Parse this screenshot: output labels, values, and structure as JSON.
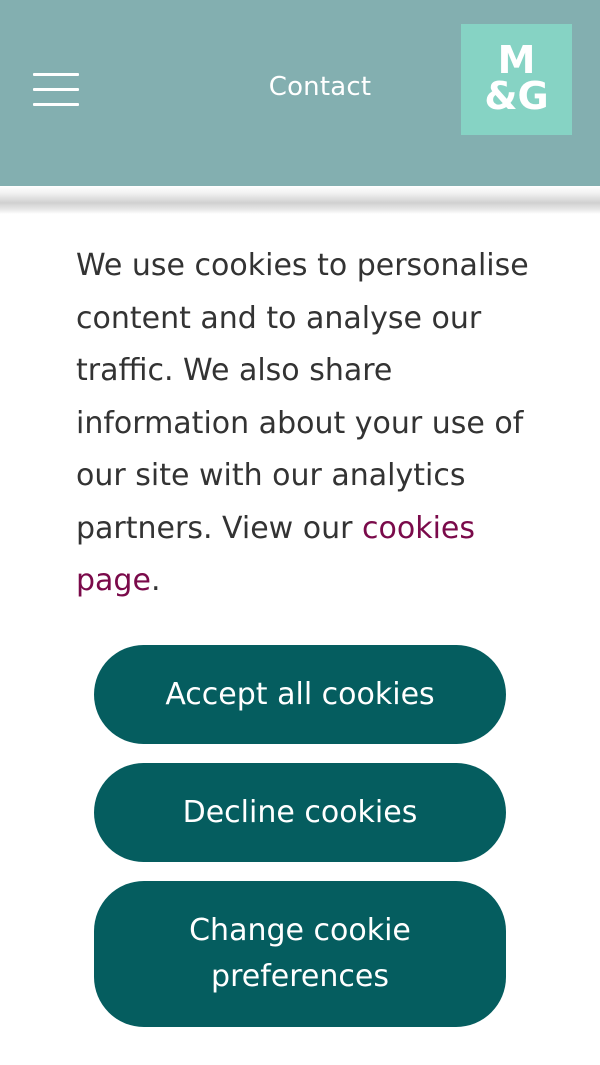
{
  "header": {
    "menu_icon": "hamburger-menu-icon",
    "contact_label": "Contact",
    "logo": {
      "line1": "M",
      "line2": "&G"
    },
    "colors": {
      "background": "#83afb0",
      "logo_background": "#86d3c4"
    }
  },
  "cookie_banner": {
    "text_before_link": "We use cookies to personalise content and to analyse our traffic. We also share information about your use of our site with our analytics partners. View our ",
    "link_label": "cookies page",
    "text_after_link": ".",
    "accept_label": "Accept all cookies",
    "decline_label": "Decline cookies",
    "preferences_label": "Change cookie preferences",
    "colors": {
      "button": "#055d5f",
      "link": "#7a0a4a"
    }
  }
}
